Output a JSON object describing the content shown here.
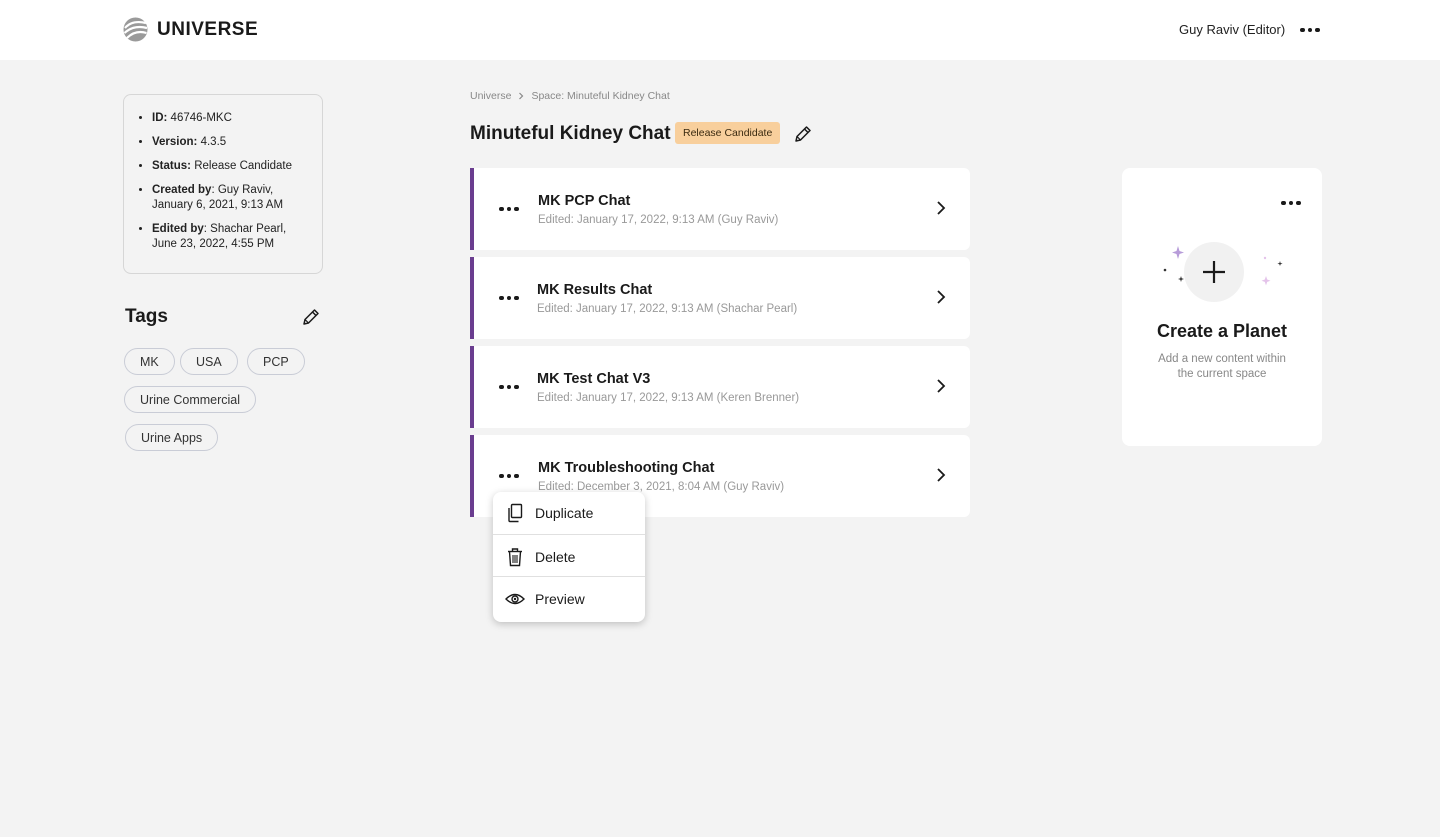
{
  "header": {
    "logo_text": "UNIVERSE",
    "user": "Guy Raviv (Editor)"
  },
  "info": {
    "id_label": "ID:",
    "id_value": "46746-MKC",
    "version_label": "Version:",
    "version_value": "4.3.5",
    "status_label": "Status:",
    "status_value": "Release Candidate",
    "created_label": "Created by",
    "created_value": ": Guy Raviv, January 6, 2021, 9:13 AM",
    "edited_label": "Edited by",
    "edited_value": ": Shachar Pearl, June 23, 2022, 4:55 PM"
  },
  "tags": {
    "title": "Tags",
    "items": [
      "MK",
      "USA",
      "PCP",
      "Urine Commercial",
      "Urine Apps"
    ]
  },
  "breadcrumb": {
    "items": [
      "Universe",
      "Space: Minuteful Kidney Chat"
    ]
  },
  "space": {
    "title": "Minuteful Kidney Chat",
    "status": "Release Candidate"
  },
  "planets": [
    {
      "title": "MK PCP Chat",
      "edited": "Edited: January 17, 2022, 9:13 AM (Guy Raviv)"
    },
    {
      "title": "MK Results Chat",
      "edited": "Edited: January 17, 2022, 9:13 AM (Shachar Pearl)"
    },
    {
      "title": "MK Test Chat V3",
      "edited": "Edited: January 17, 2022, 9:13 AM (Keren Brenner)"
    },
    {
      "title": "MK Troubleshooting Chat",
      "edited": "Edited: December 3, 2021, 8:04 AM (Guy Raviv)"
    }
  ],
  "context_menu": {
    "items": [
      {
        "label": "Duplicate",
        "icon": "copy-icon"
      },
      {
        "label": "Delete",
        "icon": "trash-icon"
      },
      {
        "label": "Preview",
        "icon": "eye-icon"
      }
    ]
  },
  "create_card": {
    "title": "Create a Planet",
    "description": "Add a new content within the current space",
    "sparkle_colors": [
      "#b79cd9",
      "#333333",
      "#e4c3ea"
    ]
  },
  "colors": {
    "accent": "#6a3d8f",
    "badge": "#f8cf9c",
    "background": "#f3f3f3"
  }
}
